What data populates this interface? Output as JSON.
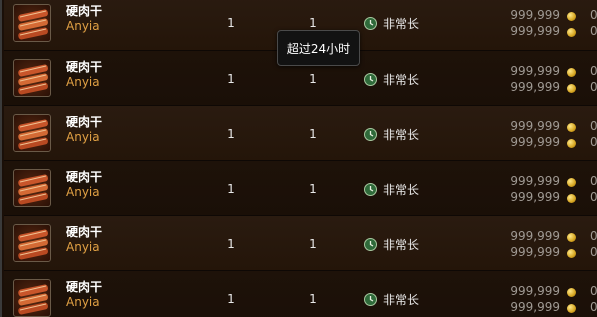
{
  "rows": [
    {
      "name": "硬肉干",
      "seller": "Anyia",
      "qty1": "1",
      "qty2": "1",
      "duration": "非常长",
      "price_bid": "999,999",
      "price_buyout": "999,999",
      "copper_bid": "0",
      "copper_buyout": "0"
    },
    {
      "name": "硬肉干",
      "seller": "Anyia",
      "qty1": "1",
      "qty2": "1",
      "duration": "非常长",
      "price_bid": "999,999",
      "price_buyout": "999,999",
      "copper_bid": "0",
      "copper_buyout": "0"
    },
    {
      "name": "硬肉干",
      "seller": "Anyia",
      "qty1": "1",
      "qty2": "1",
      "duration": "非常长",
      "price_bid": "999,999",
      "price_buyout": "999,999",
      "copper_bid": "0",
      "copper_buyout": "0"
    },
    {
      "name": "硬肉干",
      "seller": "Anyia",
      "qty1": "1",
      "qty2": "1",
      "duration": "非常长",
      "price_bid": "999,999",
      "price_buyout": "999,999",
      "copper_bid": "0",
      "copper_buyout": "0"
    },
    {
      "name": "硬肉干",
      "seller": "Anyia",
      "qty1": "1",
      "qty2": "1",
      "duration": "非常长",
      "price_bid": "999,999",
      "price_buyout": "999,999",
      "copper_bid": "0",
      "copper_buyout": "0"
    },
    {
      "name": "硬肉干",
      "seller": "Anyia",
      "qty1": "1",
      "qty2": "1",
      "duration": "非常长",
      "price_bid": "999,999",
      "price_buyout": "999,999",
      "copper_bid": "0",
      "copper_buyout": "0"
    }
  ],
  "tooltip": {
    "text": "超过24小时"
  },
  "icons": {
    "item": "jerky-meat-icon",
    "duration": "green-clock-icon",
    "currency": "gold-coin-icon"
  }
}
